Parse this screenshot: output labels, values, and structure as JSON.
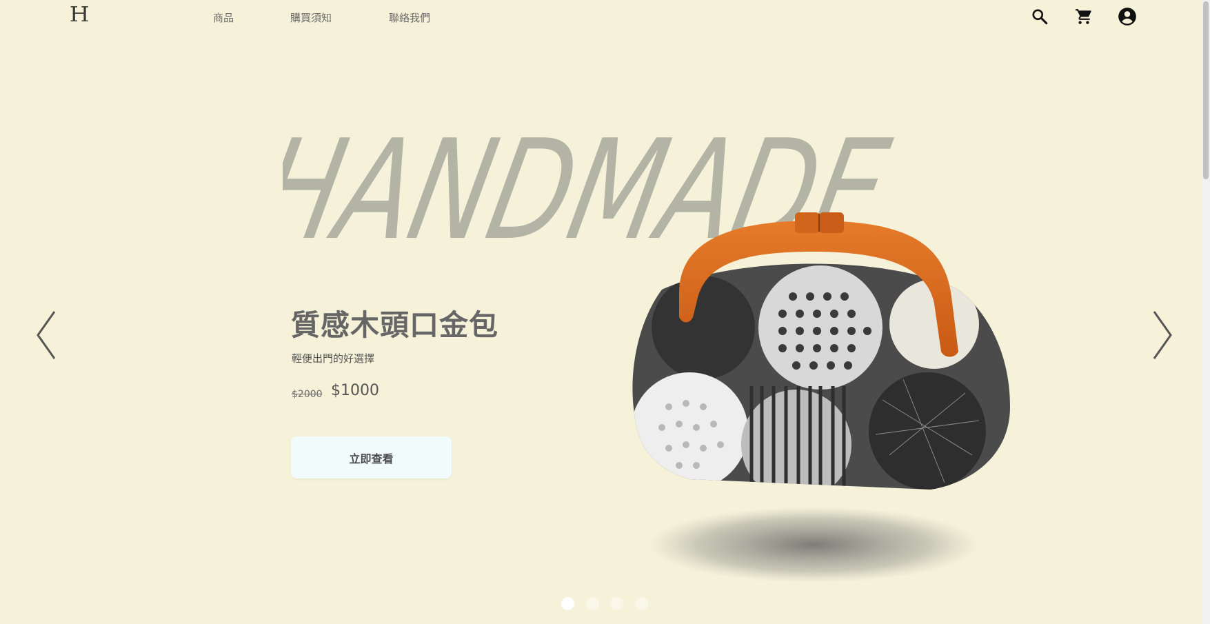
{
  "header": {
    "logo": "H",
    "nav": [
      {
        "label": "商品"
      },
      {
        "label": "購買須知"
      },
      {
        "label": "聯絡我們"
      }
    ],
    "icons": [
      "search-icon",
      "cart-icon",
      "account-icon"
    ]
  },
  "hero": {
    "background_word": "HANDMADE",
    "title": "質感木頭口金包",
    "subtitle": "輕便出門的好選擇",
    "price_original": "$2000",
    "price_sale": "$1000",
    "cta_label": "立即查看",
    "slide_count": 4,
    "active_slide": 1
  },
  "colors": {
    "background": "#f5f2d9",
    "handmade_text": "#b3b4a6",
    "cta_bg": "#f2fbfc",
    "wood": "#d86a1f"
  }
}
